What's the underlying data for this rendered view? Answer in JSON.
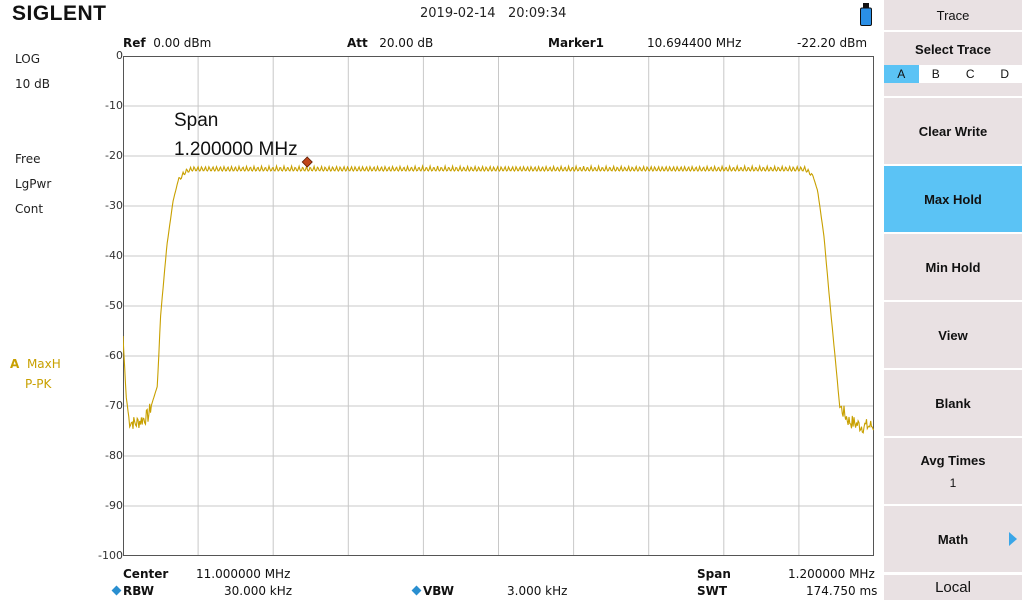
{
  "header": {
    "brand": "SIGLENT",
    "date": "2019-02-14",
    "time": "20:09:34"
  },
  "left_panel": {
    "scale_type": "LOG",
    "scale_div": "10 dB",
    "trig": "Free",
    "detector": "LgPwr",
    "sweep": "Cont",
    "trace_id": "A",
    "trace_mode": "MaxH",
    "trace_detector": "P-PK"
  },
  "top_bar": {
    "ref_label": "Ref",
    "ref_value": "0.00 dBm",
    "att_label": "Att",
    "att_value": "20.00 dB",
    "marker_label": "Marker1",
    "marker_freq": "10.694400 MHz",
    "marker_level": "-22.20 dBm"
  },
  "annotation": {
    "line1": "Span",
    "line2": "1.200000 MHz"
  },
  "bottom_bar": {
    "center_label": "Center",
    "center_value": "11.000000 MHz",
    "span_label": "Span",
    "span_value": "1.200000 MHz",
    "rbw_label": "RBW",
    "rbw_value": "30.000 kHz",
    "vbw_label": "VBW",
    "vbw_value": "3.000 kHz",
    "swt_label": "SWT",
    "swt_value": "174.750 ms"
  },
  "menu": {
    "title": "Trace",
    "select_trace": "Select Trace",
    "trace_options": [
      "A",
      "B",
      "C",
      "D"
    ],
    "selected_trace": "A",
    "buttons": [
      {
        "label": "Clear Write",
        "active": false
      },
      {
        "label": "Max Hold",
        "active": true
      },
      {
        "label": "Min Hold",
        "active": false
      },
      {
        "label": "View",
        "active": false
      },
      {
        "label": "Blank",
        "active": false
      },
      {
        "label": "Avg Times",
        "sub": "1",
        "active": false
      },
      {
        "label": "Math",
        "active": false,
        "has_submenu": true
      }
    ],
    "local": "Local"
  },
  "chart_data": {
    "type": "line",
    "x_range_mhz": [
      10.4,
      11.6
    ],
    "ylim": [
      -100,
      0
    ],
    "yticks": [
      "0",
      "-10",
      "-20",
      "-30",
      "-40",
      "-50",
      "-60",
      "-70",
      "-80",
      "-90",
      "-100"
    ],
    "grid": true,
    "trace_color": "#c8a000",
    "series": [
      {
        "x": [
          10.4,
          10.405,
          10.41,
          10.42,
          10.44,
          10.455,
          10.46,
          10.47,
          10.48,
          10.49,
          10.5,
          10.51,
          10.52,
          11.48,
          11.49,
          11.5,
          11.51,
          11.52,
          11.53,
          11.54,
          11.545,
          11.56,
          11.58,
          11.6
        ],
        "y": [
          -56,
          -68,
          -73,
          -73.5,
          -72,
          -66,
          -52,
          -38,
          -29,
          -24,
          -22.5,
          -22,
          -22,
          -22,
          -22,
          -23,
          -27,
          -36,
          -50,
          -63,
          -70,
          -73,
          -74,
          -74
        ]
      }
    ],
    "marker": {
      "x": 10.6944,
      "y": -21.2,
      "color": "#c0451a"
    }
  }
}
